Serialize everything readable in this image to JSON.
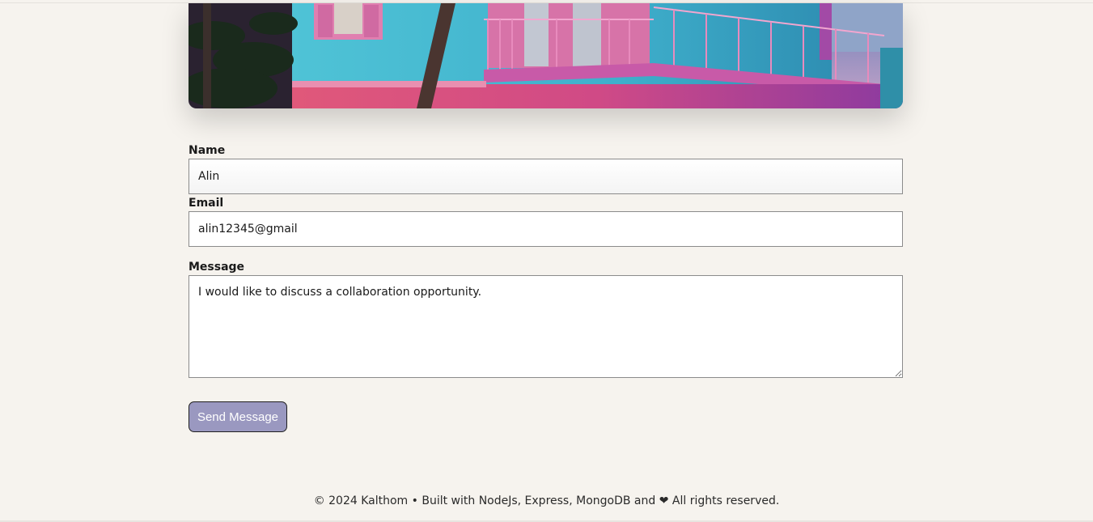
{
  "form": {
    "name": {
      "label": "Name",
      "value": "Alin"
    },
    "email": {
      "label": "Email",
      "value": "alin12345@gmail"
    },
    "message": {
      "label": "Message",
      "value": "I would like to discuss a collaboration opportunity."
    },
    "submit_label": "Send Message"
  },
  "footer": {
    "text": "© 2024 Kalthom • Built with NodeJs, Express, MongoDB and ❤ All rights reserved."
  },
  "colors": {
    "page_background": "#f6f3ee",
    "button_background": "#9a98c0",
    "field_border": "#8b8b8b"
  }
}
